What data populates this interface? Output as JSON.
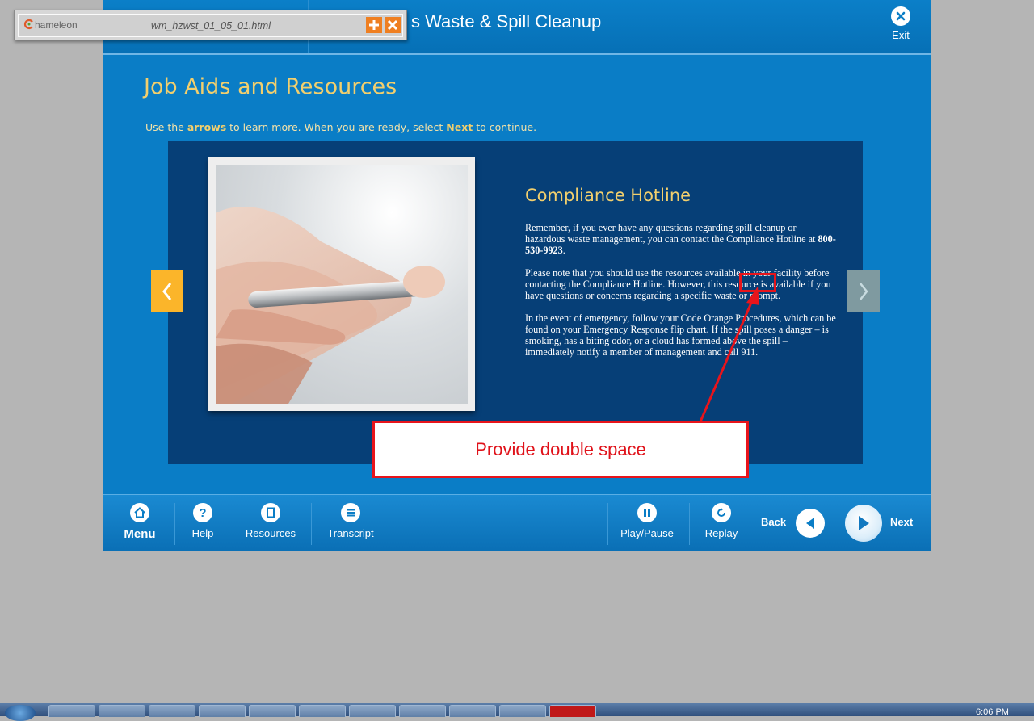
{
  "course": {
    "title_partial": "s Waste & Spill Cleanup",
    "exit_label": "Exit"
  },
  "page": {
    "title": "Job Aids and Resources",
    "instruction_prefix": "Use the ",
    "instruction_arrows": "arrows",
    "instruction_middle": " to learn more.  When you are ready, select ",
    "instruction_next": "Next",
    "instruction_suffix": " to continue."
  },
  "content": {
    "heading": "Compliance Hotline",
    "p1_text": "Remember, if you ever have any questions regarding spill cleanup or hazardous waste management, you can contact the Compliance Hotline at ",
    "p1_phone": "800-530-9923",
    "p1_end": ".",
    "p2": "Please note that you should use the resources available in your facility before contacting the Compliance Hotline. However, this resource is available if you have questions or concerns regarding a specific waste or prompt.",
    "p3": "In the event of emergency, follow your Code Orange Procedures, which can be found on your Emergency Response flip chart.  If the spill poses a danger – is smoking, has a biting odor, or a cloud has formed above the spill – immediately notify a member of management and call 911."
  },
  "footer": {
    "menu": "Menu",
    "help": "Help",
    "resources": "Resources",
    "transcript": "Transcript",
    "play_pause": "Play/Pause",
    "replay": "Replay",
    "back": "Back",
    "next": "Next"
  },
  "annotation": {
    "callout": "Provide double space"
  },
  "chameleon": {
    "logo": "hameleon",
    "filename": "wm_hzwst_01_05_01.html"
  },
  "taskbar": {
    "clock": "6:06 PM"
  },
  "colors": {
    "frame_blue": "#0a7dc6",
    "panel_navy": "#063f77",
    "gold": "#f2cf6d",
    "prev_arrow": "#fbb52a",
    "annotation_red": "#e8141b",
    "chameleon_orange": "#ef7f21"
  }
}
